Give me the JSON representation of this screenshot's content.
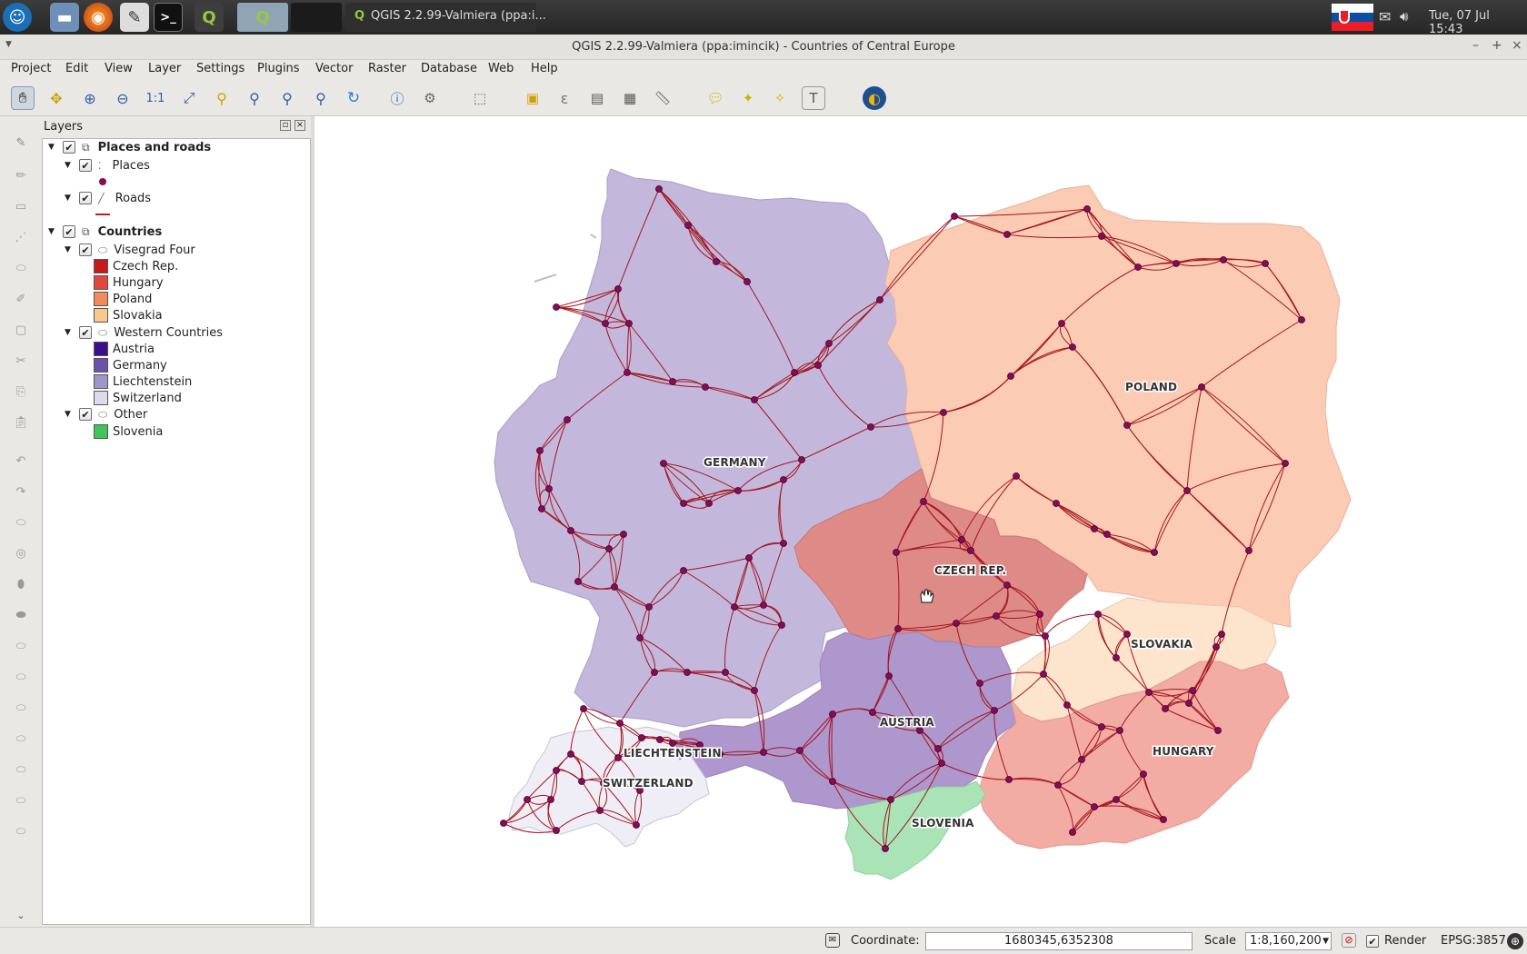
{
  "taskbar": {
    "active_window_title": "QGIS 2.2.99-Valmiera (ppa:i...",
    "clock": "Tue, 07 Jul  15:43"
  },
  "window": {
    "title": "QGIS 2.2.99-Valmiera (ppa:imincik) - Countries of Central Europe"
  },
  "menu": [
    "Project",
    "Edit",
    "View",
    "Layer",
    "Settings",
    "Plugins",
    "Vector",
    "Raster",
    "Database",
    "Web",
    "Help"
  ],
  "layers_panel": {
    "title": "Layers",
    "groups": [
      {
        "label": "Places and roads",
        "children": [
          {
            "label": "Places"
          },
          {
            "label": "Roads"
          }
        ]
      },
      {
        "label": "Countries",
        "children": [
          {
            "label": "Visegrad Four",
            "items": [
              {
                "label": "Czech Rep.",
                "color": "#c8191a"
              },
              {
                "label": "Hungary",
                "color": "#e1473a"
              },
              {
                "label": "Poland",
                "color": "#f28a5c"
              },
              {
                "label": "Slovakia",
                "color": "#f9c98c"
              }
            ]
          },
          {
            "label": "Western Countries",
            "items": [
              {
                "label": "Austria",
                "color": "#3b0f8c"
              },
              {
                "label": "Germany",
                "color": "#6a52a8"
              },
              {
                "label": "Liechtenstein",
                "color": "#9e95c9"
              },
              {
                "label": "Switzerland",
                "color": "#dcdbec"
              }
            ]
          },
          {
            "label": "Other",
            "items": [
              {
                "label": "Slovenia",
                "color": "#3ec45b"
              }
            ]
          }
        ]
      }
    ]
  },
  "map": {
    "country_labels": {
      "germany": "GERMANY",
      "poland": "POLAND",
      "czech": "CZECH REP.",
      "slovakia": "SLOVAKIA",
      "austria": "AUSTRIA",
      "hungary": "HUNGARY",
      "liechtenstein": "LIECHTENSTEIN",
      "switzerland": "SWITZERLAND",
      "slovenia": "SLOVENIA"
    },
    "fill_colors": {
      "germany": "#c3b8dc",
      "poland": "#fbcbb4",
      "czech": "#de8a86",
      "slovakia": "#fde4cc",
      "austria": "#ad97cd",
      "hungary": "#f2aca4",
      "switzerland": "#efedf5",
      "slovenia": "#a9e3b6"
    },
    "road_color": "#a4151e",
    "place_color": "#8a0a5a"
  },
  "status": {
    "coordinate_label": "Coordinate:",
    "coordinate_value": "1680345,6352308",
    "scale_label": "Scale",
    "scale_value": "1:8,160,200",
    "render_label": "Render",
    "crs": "EPSG:3857"
  }
}
